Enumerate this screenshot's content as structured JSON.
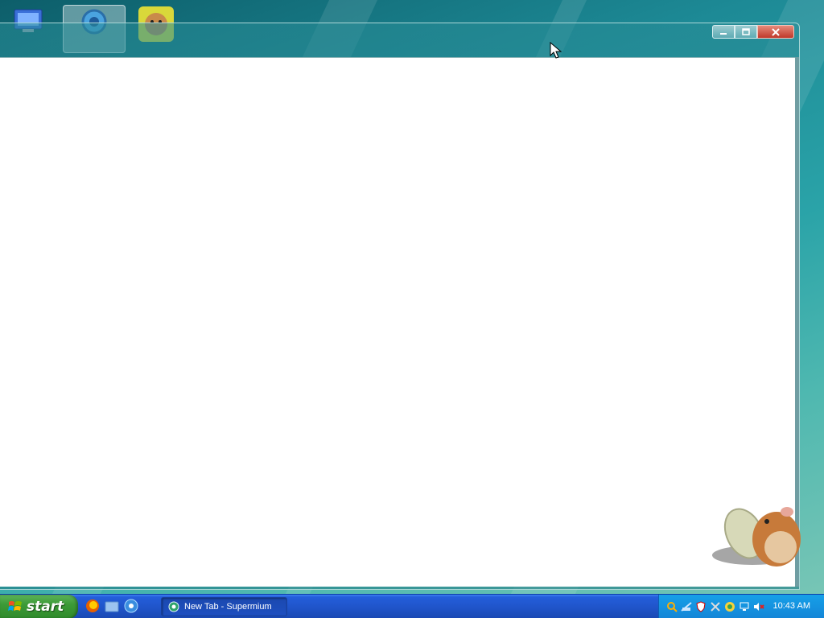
{
  "desktop": {
    "icons": [
      "computer-icon",
      "browser-icon",
      "hamster-icon"
    ]
  },
  "window": {
    "caption_buttons": {
      "minimize_icon": "minimize-icon",
      "maximize_icon": "maximize-icon",
      "close_icon": "close-icon"
    }
  },
  "taskbar": {
    "start_label": "start",
    "quick_launch": [
      "firefox-icon",
      "folder-icon",
      "browser-icon"
    ],
    "tasks": [
      {
        "label": "New Tab - Supermium",
        "icon": "supermium-icon"
      }
    ],
    "tray": {
      "icons": [
        "search-icon",
        "network-icon",
        "shield-icon",
        "tools-icon",
        "update-icon",
        "network-connection-icon",
        "volume-muted-icon"
      ],
      "clock": "10:43 AM"
    }
  },
  "colors": {
    "taskbar": "#245edb",
    "start_button": "#3c9a37",
    "tray": "#1485d7",
    "close_button": "#c0392b"
  }
}
